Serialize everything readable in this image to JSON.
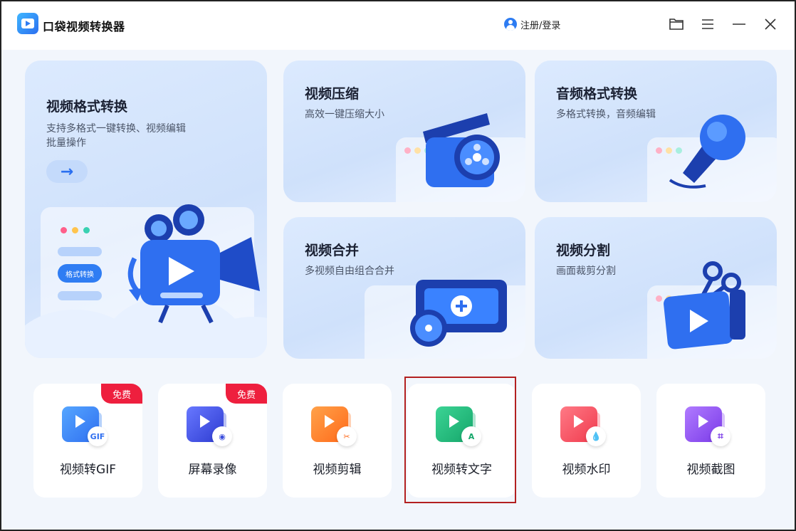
{
  "app": {
    "title": "口袋视频转换器",
    "login_label": "注册/登录"
  },
  "cards": {
    "format": {
      "title": "视频格式转换",
      "sub1": "支持多格式一键转换、视频编辑",
      "sub2": "批量操作",
      "chip": "格式转换",
      "arrow": "→"
    },
    "compress": {
      "title": "视频压缩",
      "sub": "高效一键压缩大小"
    },
    "audio": {
      "title": "音频格式转换",
      "sub": "多格式转换，音频编辑"
    },
    "merge": {
      "title": "视频合并",
      "sub": "多视频自由组合合并"
    },
    "split": {
      "title": "视频分割",
      "sub": "画面裁剪分割"
    }
  },
  "tools": [
    {
      "label": "视频转GIF",
      "badge": "免费",
      "glyph": "GIF"
    },
    {
      "label": "屏幕录像",
      "badge": "免费",
      "glyph": "◉"
    },
    {
      "label": "视频剪辑",
      "glyph": "✂"
    },
    {
      "label": "视频转文字",
      "glyph": "A"
    },
    {
      "label": "视频水印",
      "glyph": "💧"
    },
    {
      "label": "视频截图",
      "glyph": "⌗"
    }
  ],
  "colors": {
    "accent": "#2f7df3",
    "badge": "#ee1f3e",
    "highlight_border": "#b32020"
  }
}
